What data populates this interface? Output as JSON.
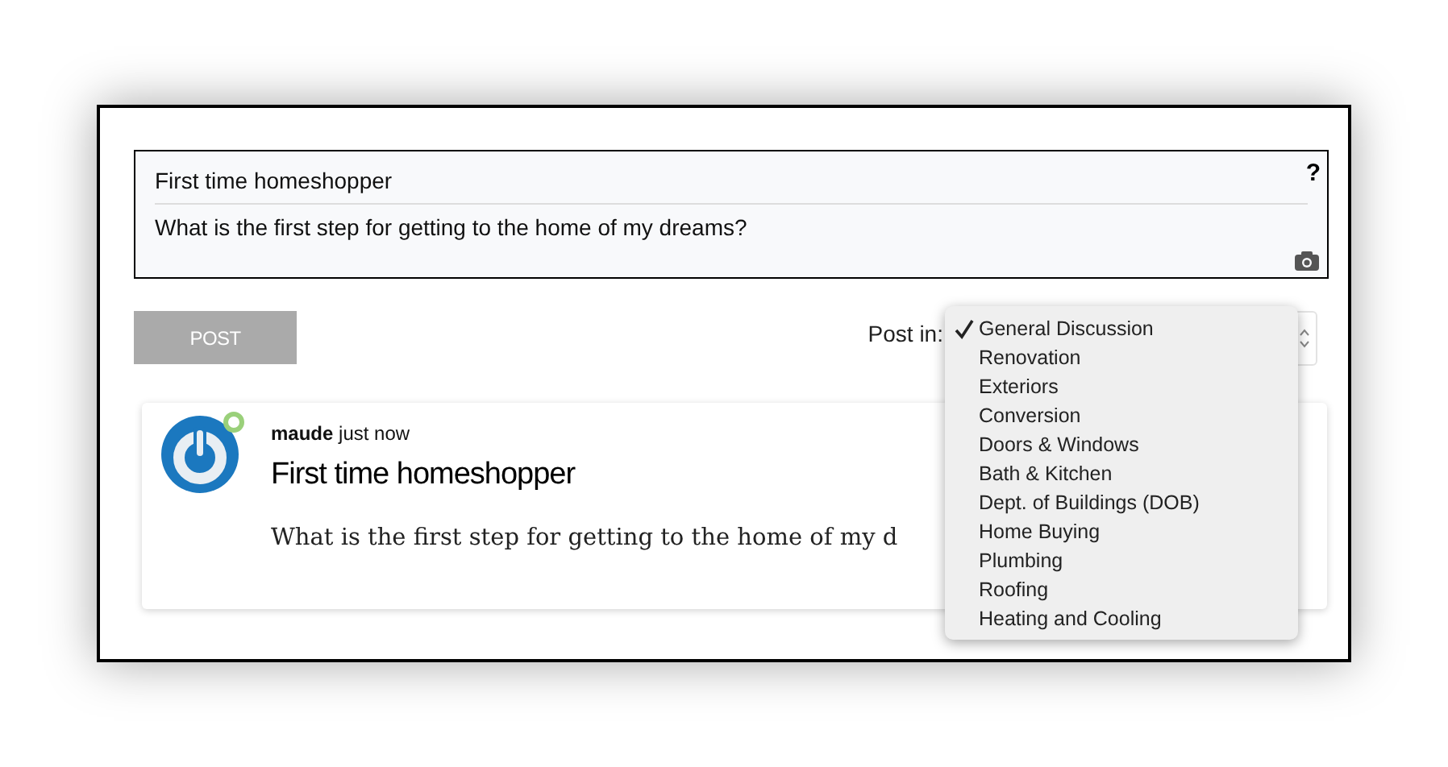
{
  "composer": {
    "title": "First time homeshopper",
    "body": "What is the first step for getting to the home of my dreams?",
    "help": "?"
  },
  "post_button": "POST",
  "post_in_label": "Post in:",
  "category_menu": [
    {
      "label": "General Discussion",
      "selected": true
    },
    {
      "label": "Renovation",
      "selected": false
    },
    {
      "label": "Exteriors",
      "selected": false
    },
    {
      "label": "Conversion",
      "selected": false
    },
    {
      "label": "Doors & Windows",
      "selected": false
    },
    {
      "label": "Bath & Kitchen",
      "selected": false
    },
    {
      "label": "Dept. of Buildings (DOB)",
      "selected": false
    },
    {
      "label": "Home Buying",
      "selected": false
    },
    {
      "label": "Plumbing",
      "selected": false
    },
    {
      "label": "Roofing",
      "selected": false
    },
    {
      "label": "Heating and Cooling",
      "selected": false
    }
  ],
  "post": {
    "author": "maude",
    "time": "just now",
    "online": true,
    "title": "First time homeshopper",
    "body": "What is the first step for getting to the home of my d"
  }
}
